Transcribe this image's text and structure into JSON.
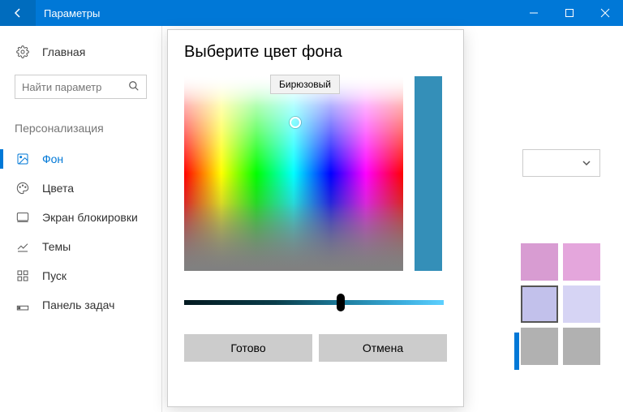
{
  "window": {
    "title": "Параметры"
  },
  "sidebar": {
    "home": "Главная",
    "search_placeholder": "Найти параметр",
    "group": "Персонализация",
    "items": [
      {
        "label": "Фон",
        "active": true
      },
      {
        "label": "Цвета"
      },
      {
        "label": "Экран блокировки"
      },
      {
        "label": "Темы"
      },
      {
        "label": "Пуск"
      },
      {
        "label": "Панель задач"
      }
    ]
  },
  "swatches": [
    [
      "#d89cd2",
      "#e4a6dc"
    ],
    [
      "#c2c1eb",
      "#d6d4f4"
    ],
    [
      "#b1b1b1",
      "#b1b1b1"
    ]
  ],
  "swatch_selected": [
    1,
    0
  ],
  "picker": {
    "title": "Выберите цвет фона",
    "tooltip": "Бирюзовый",
    "preview_color": "#348fb8",
    "done": "Готово",
    "cancel": "Отмена"
  }
}
